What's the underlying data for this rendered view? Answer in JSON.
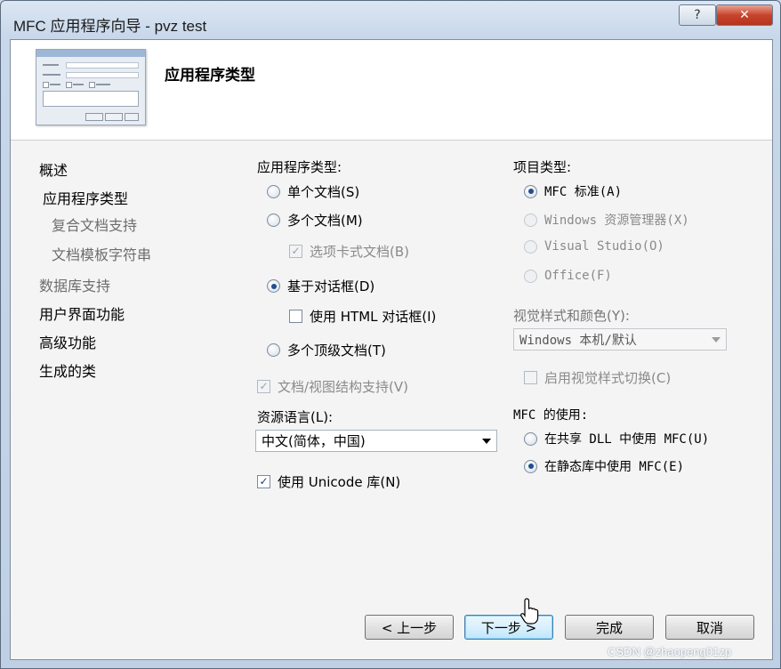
{
  "window": {
    "title": "MFC 应用程序向导 - pvz test",
    "help_label": "?",
    "close_label": "✕"
  },
  "header": {
    "title": "应用程序类型"
  },
  "nav": {
    "items": [
      {
        "label": "概述",
        "enabled": true
      },
      {
        "label": "应用程序类型",
        "enabled": true
      },
      {
        "label": "复合文档支持",
        "enabled": false
      },
      {
        "label": "文档模板字符串",
        "enabled": false
      },
      {
        "label": "数据库支持",
        "enabled": false
      },
      {
        "label": "用户界面功能",
        "enabled": true
      },
      {
        "label": "高级功能",
        "enabled": true
      },
      {
        "label": "生成的类",
        "enabled": true
      }
    ]
  },
  "app_type": {
    "label": "应用程序类型:",
    "single_doc": "单个文档(S)",
    "multi_doc": "多个文档(M)",
    "tabbed_docs": "选项卡式文档(B)",
    "dialog_based": "基于对话框(D)",
    "use_html_dialog": "使用 HTML 对话框(I)",
    "multi_toplevel": "多个顶级文档(T)",
    "doc_view": "文档/视图结构支持(V)",
    "selected": "dialog_based"
  },
  "resource_lang": {
    "label": "资源语言(L):",
    "value": "中文(简体，中国)"
  },
  "unicode": {
    "label": "使用 Unicode 库(N)",
    "checked": true
  },
  "project_type": {
    "label": "项目类型:",
    "mfc_standard": "MFC 标准(A)",
    "windows_explorer": "Windows 资源管理器(X)",
    "visual_studio": "Visual Studio(O)",
    "office": "Office(F)",
    "selected": "mfc_standard"
  },
  "visual_style": {
    "label": "视觉样式和颜色(Y):",
    "value": "Windows 本机/默认",
    "switch_label": "启用视觉样式切换(C)"
  },
  "mfc_use": {
    "label": "MFC 的使用:",
    "shared_dll": "在共享 DLL 中使用 MFC(U)",
    "static_lib": "在静态库中使用 MFC(E)",
    "selected": "static_lib"
  },
  "buttons": {
    "prev": "< 上一步",
    "next": "下一步 >",
    "finish": "完成",
    "cancel": "取消"
  },
  "watermark": "CSDN @zhaopeng01zp"
}
